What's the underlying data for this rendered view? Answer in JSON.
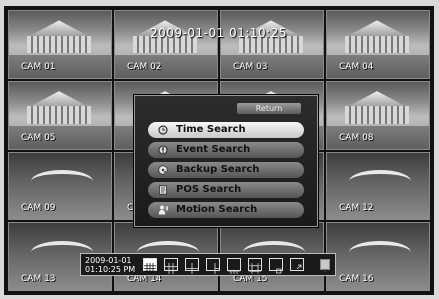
{
  "clock": "2009-01-01  01:10:25",
  "cameras": [
    {
      "label": "CAM 01"
    },
    {
      "label": "CAM 02"
    },
    {
      "label": "CAM 03"
    },
    {
      "label": "CAM 04"
    },
    {
      "label": "CAM 05"
    },
    {
      "label": ""
    },
    {
      "label": ""
    },
    {
      "label": "CAM 08"
    },
    {
      "label": "CAM 09"
    },
    {
      "label": "C"
    },
    {
      "label": ""
    },
    {
      "label": "CAM 12"
    },
    {
      "label": "CAM 13"
    },
    {
      "label": "CAM 14"
    },
    {
      "label": "CAM 15"
    },
    {
      "label": "CAM 16"
    }
  ],
  "search_menu": {
    "return_label": "Return",
    "items": [
      {
        "label": "Time Search",
        "icon": "clock-icon",
        "selected": true
      },
      {
        "label": "Event Search",
        "icon": "event-icon",
        "selected": false
      },
      {
        "label": "Backup Search",
        "icon": "backup-disc-icon",
        "selected": false
      },
      {
        "label": "POS Search",
        "icon": "pos-receipt-icon",
        "selected": false
      },
      {
        "label": "Motion Search",
        "icon": "motion-person-icon",
        "selected": false
      }
    ]
  },
  "toolbar": {
    "date": "2009-01-01",
    "time": "01:10:25  PM",
    "layouts": [
      {
        "name": "split-16-icon",
        "active": true
      },
      {
        "name": "split-9-icon",
        "active": false
      },
      {
        "name": "split-4-icon",
        "active": false
      },
      {
        "name": "split-6-icon",
        "active": false
      },
      {
        "name": "split-8-icon",
        "active": false
      },
      {
        "name": "split-13-icon",
        "active": false
      },
      {
        "name": "pip-icon",
        "active": false
      },
      {
        "name": "sequence-icon",
        "active": false
      },
      {
        "name": "more-arrow-icon",
        "active": false
      }
    ]
  },
  "colors": {
    "selected_item": "#f0f0f0",
    "menu_item": "#6e6e6e",
    "menu_bg": "#222222"
  }
}
